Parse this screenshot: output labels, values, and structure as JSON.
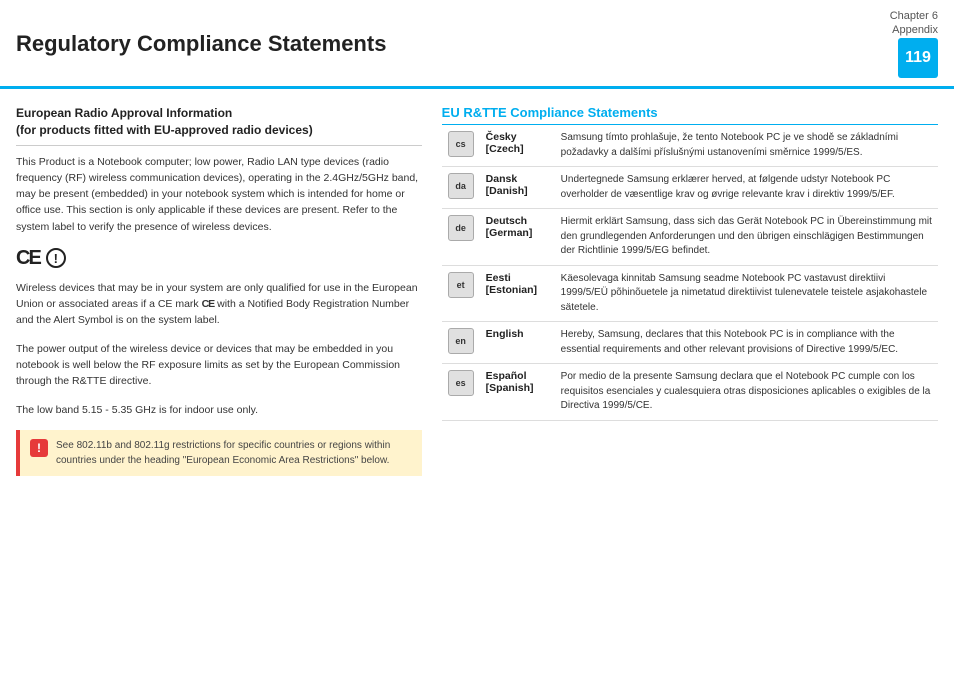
{
  "header": {
    "title": "Regulatory Compliance Statements",
    "chapter_label": "Chapter 6",
    "chapter_sublabel": "Appendix",
    "page_number": "119"
  },
  "left": {
    "section_heading_line1": "European Radio Approval Information",
    "section_heading_line2": "(for products fitted with EU-approved radio devices)",
    "body_text_1": "This Product is a Notebook computer; low power, Radio LAN type devices (radio frequency (RF) wireless communication devices), operating in the 2.4GHz/5GHz band, may be present (embedded) in your notebook system which is intended for home or office use. This section is only applicable if these devices are present. Refer to the system label to verify the presence of wireless devices.",
    "body_text_2": "Wireless devices that may be in your system are only qualified for use in the European Union or associated areas if a CE mark CE with a Notified Body Registration Number and the Alert Symbol is on the system label.",
    "body_text_3": "The power output of the wireless device or devices that may be embedded in you notebook is well below the RF exposure limits as set by the European Commission through the R&TTE directive.",
    "body_text_4": "The low band 5.15 - 5.35 GHz is for indoor use only.",
    "alert_text": "See 802.11b and 802.11g restrictions for specific countries or regions within countries under the heading \"European Economic Area Restrictions\" below."
  },
  "right": {
    "section_heading": "EU R&TTE Compliance Statements",
    "languages": [
      {
        "icon": "cs",
        "name_line1": "Česky",
        "name_line2": "[Czech]",
        "text": "Samsung tímto prohlašuje, že tento Notebook PC je ve shodě se základními požadavky a dalšími příslušnými ustanoveními směrnice 1999/5/ES."
      },
      {
        "icon": "da",
        "name_line1": "Dansk",
        "name_line2": "[Danish]",
        "text": "Undertegnede Samsung erklærer herved, at følgende udstyr Notebook PC overholder de væsentlige krav og øvrige relevante krav i direktiv 1999/5/EF."
      },
      {
        "icon": "de",
        "name_line1": "Deutsch",
        "name_line2": "[German]",
        "text": "Hiermit erklärt Samsung, dass sich das Gerät Notebook PC in Übereinstimmung mit den grundlegenden Anforderungen und den übrigen einschlägigen Bestimmungen der Richtlinie 1999/5/EG befindet."
      },
      {
        "icon": "et",
        "name_line1": "Eesti",
        "name_line2": "[Estonian]",
        "text": "Käesolevaga kinnitab Samsung seadme Notebook PC vastavust direktiivi 1999/5/EÜ põhinõuetele ja nimetatud direktiivist tulenevatele teistele asjakohastele sätetele."
      },
      {
        "icon": "en",
        "name_line1": "English",
        "name_line2": "",
        "text": "Hereby, Samsung, declares that this Notebook PC is in compliance with the essential requirements and other relevant provisions of Directive 1999/5/EC."
      },
      {
        "icon": "es",
        "name_line1": "Español",
        "name_line2": "[Spanish]",
        "text": "Por medio de la presente Samsung declara que el Notebook PC cumple con los requisitos esenciales y cualesquiera otras disposiciones aplicables o exigibles de la Directiva 1999/5/CE."
      }
    ]
  }
}
